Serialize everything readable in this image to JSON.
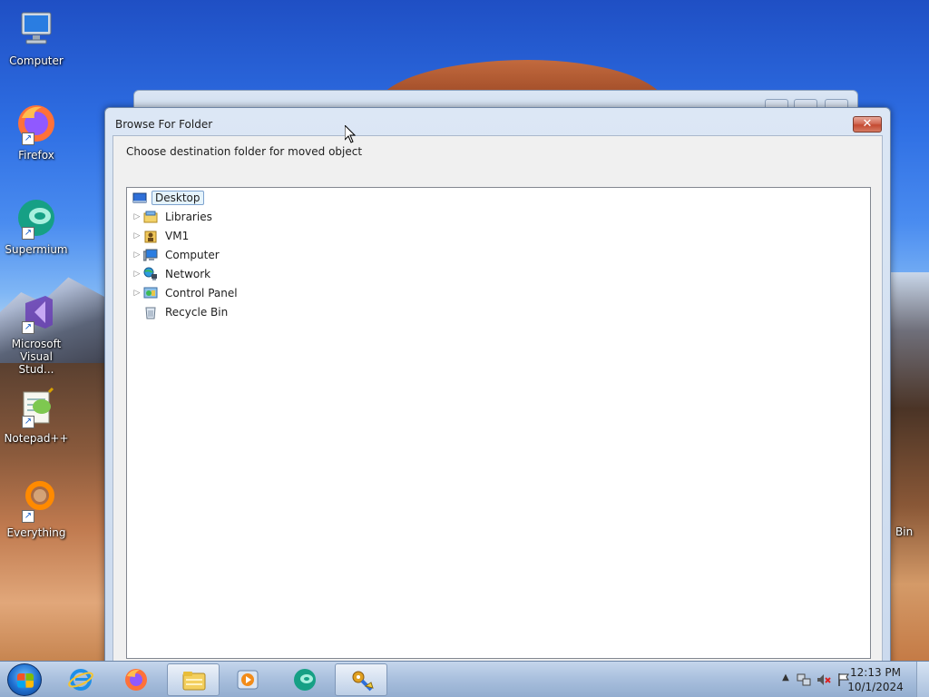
{
  "desktop": {
    "icons": [
      {
        "label": "Computer",
        "icon": "computer-icon"
      },
      {
        "label": "Firefox",
        "icon": "firefox-icon"
      },
      {
        "label": "Supermium",
        "icon": "supermium-icon"
      },
      {
        "label": "Microsoft Visual Stud...",
        "icon": "visual-studio-icon"
      },
      {
        "label": "Notepad++",
        "icon": "notepad-plus-plus-icon"
      },
      {
        "label": "Everything",
        "icon": "everything-search-icon"
      }
    ],
    "right_partial_label": "Bin"
  },
  "dialog": {
    "title": "Browse For Folder",
    "close_label": "✕",
    "instruction": "Choose destination folder for moved object",
    "tree": [
      {
        "label": "Desktop",
        "icon": "desktop-icon",
        "expandable": false,
        "selected": true
      },
      {
        "label": "Libraries",
        "icon": "libraries-icon",
        "expandable": true
      },
      {
        "label": "VM1",
        "icon": "user-folder-icon",
        "expandable": true
      },
      {
        "label": "Computer",
        "icon": "computer-icon",
        "expandable": true
      },
      {
        "label": "Network",
        "icon": "network-icon",
        "expandable": true
      },
      {
        "label": "Control Panel",
        "icon": "control-panel-icon",
        "expandable": true
      },
      {
        "label": "Recycle Bin",
        "icon": "recycle-bin-icon",
        "expandable": false
      }
    ]
  },
  "taskbar": {
    "buttons": [
      {
        "name": "internet-explorer",
        "icon": "internet-explorer-icon"
      },
      {
        "name": "firefox",
        "icon": "firefox-icon"
      },
      {
        "name": "file-explorer",
        "icon": "folder-icon",
        "active": true
      },
      {
        "name": "media-player",
        "icon": "media-player-icon"
      },
      {
        "name": "supermium",
        "icon": "supermium-icon"
      },
      {
        "name": "tweak-tool",
        "icon": "settings-tool-icon",
        "active": true
      }
    ],
    "clock": {
      "time": "12:13 PM",
      "date": "10/1/2024"
    },
    "tray": [
      "show-hidden-icons-icon",
      "network-icon",
      "volume-muted-icon",
      "action-center-flag-icon"
    ]
  },
  "colors": {
    "accent": "#1f6fd0",
    "close_button": "#c44a32",
    "selection": "#e5f3fb"
  }
}
